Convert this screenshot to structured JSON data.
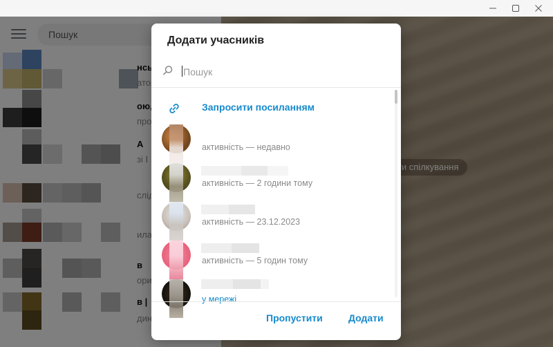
{
  "window": {
    "controls": [
      "minimize-icon",
      "maximize-icon",
      "close-icon"
    ]
  },
  "sidebar": {
    "search_placeholder": "Пошук",
    "fragments": [
      "нсь",
      "атор",
      "ою,",
      "про",
      "А",
      "зі І",
      "слід",
      "ила",
      "в",
      "ори",
      "в |",
      "дин із постра..."
    ]
  },
  "wallpaper": {
    "pill_text": "ати спілкування"
  },
  "dialog": {
    "title": "Додати учасників",
    "search_placeholder": "Пошук",
    "invite_label": "Запросити посиланням",
    "members": [
      {
        "status": "активність — недавно"
      },
      {
        "status": "активність — 2 години тому"
      },
      {
        "status": "активність — 23.12.2023"
      },
      {
        "status": "активність — 5 годин тому"
      },
      {
        "status": "у мережі"
      }
    ],
    "skip_label": "Пропустити",
    "add_label": "Додати"
  },
  "colors": {
    "accent": "#168acd",
    "muted_text": "#8a8a8a",
    "overlay": "rgba(0,0,0,0.5)"
  }
}
